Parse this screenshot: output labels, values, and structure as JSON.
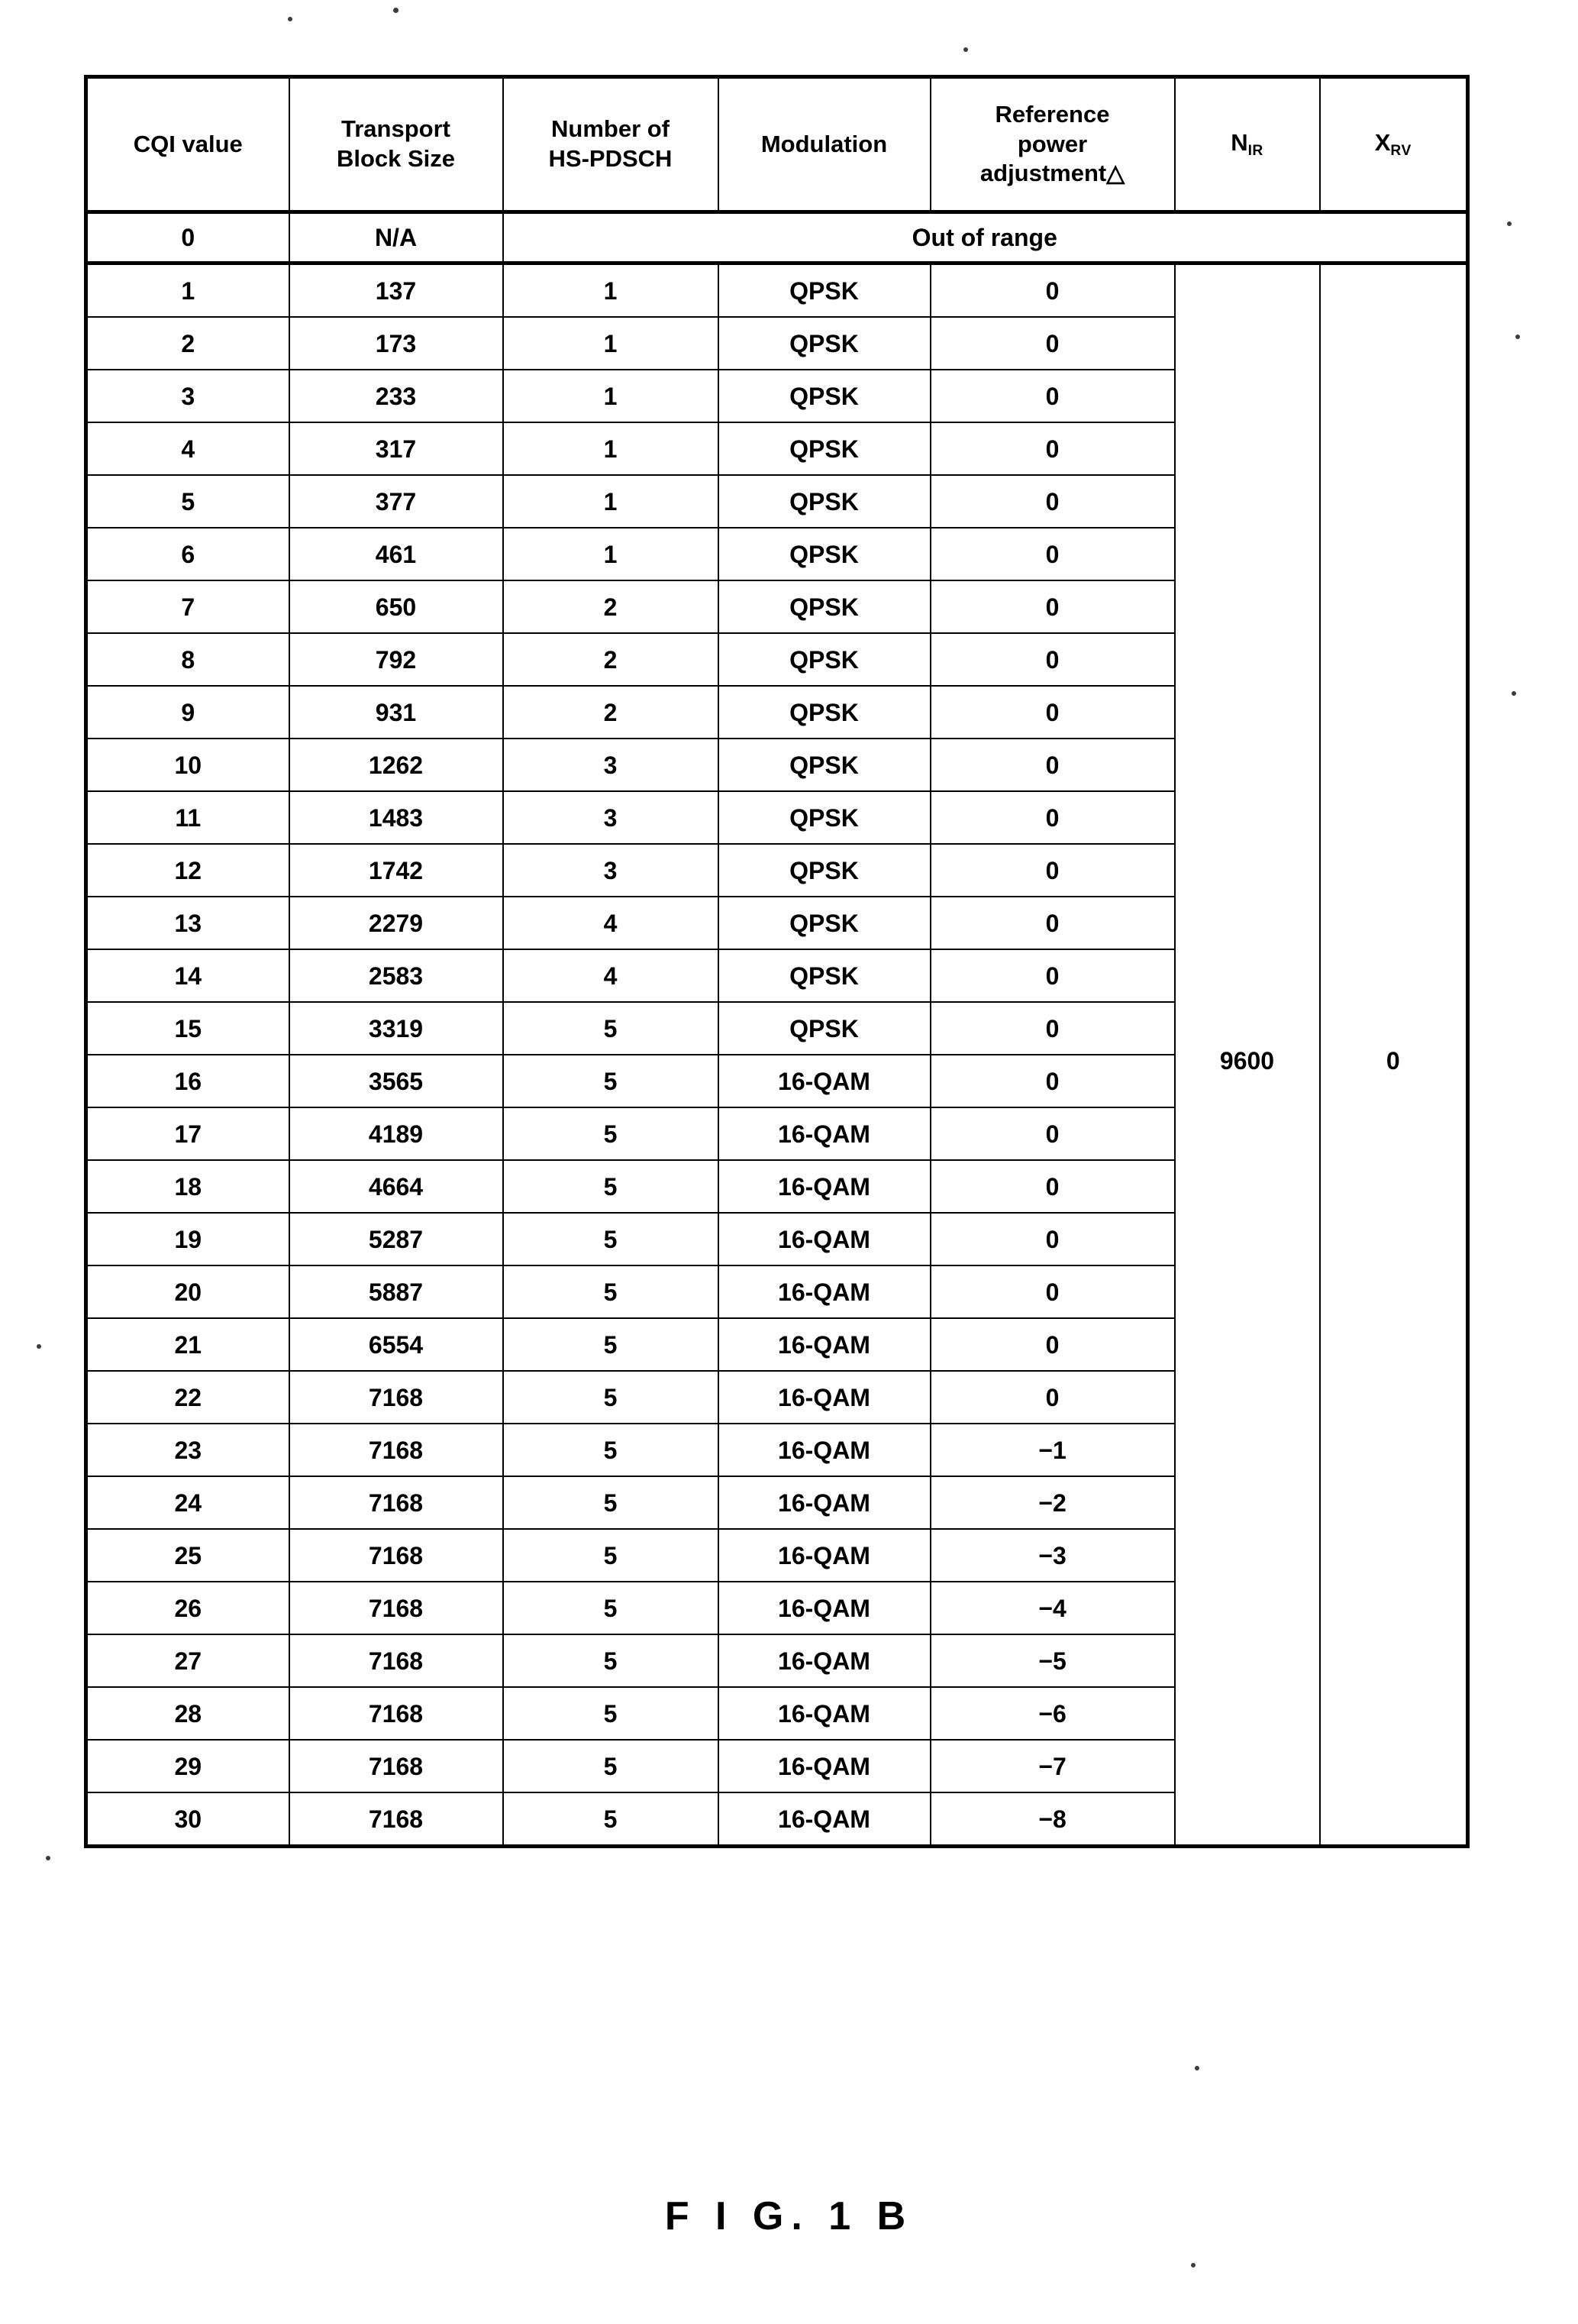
{
  "figure": {
    "caption": "F I G.  1 B"
  },
  "table": {
    "columns": [
      {
        "id": "cqi",
        "label_lines": [
          "CQI value"
        ]
      },
      {
        "id": "tbs",
        "label_lines": [
          "Transport",
          "Block Size"
        ]
      },
      {
        "id": "pdsch",
        "label_lines": [
          "Number of",
          "HS-PDSCH"
        ]
      },
      {
        "id": "mod",
        "label_lines": [
          "Modulation"
        ]
      },
      {
        "id": "ref",
        "label_lines": [
          "Reference",
          "power",
          "adjustment△"
        ]
      },
      {
        "id": "nir",
        "label_lines": [
          "N"
        ],
        "label_sub": "IR"
      },
      {
        "id": "xrv",
        "label_lines": [
          "X"
        ],
        "label_sub": "RV"
      }
    ],
    "out_of_range_label": "Out of range",
    "nir_value": "9600",
    "xrv_value": "0",
    "rows": [
      {
        "cqi": "0",
        "tbs": "N/A",
        "pdsch": "",
        "mod": "",
        "ref": ""
      },
      {
        "cqi": "1",
        "tbs": "137",
        "pdsch": "1",
        "mod": "QPSK",
        "ref": "0"
      },
      {
        "cqi": "2",
        "tbs": "173",
        "pdsch": "1",
        "mod": "QPSK",
        "ref": "0"
      },
      {
        "cqi": "3",
        "tbs": "233",
        "pdsch": "1",
        "mod": "QPSK",
        "ref": "0"
      },
      {
        "cqi": "4",
        "tbs": "317",
        "pdsch": "1",
        "mod": "QPSK",
        "ref": "0"
      },
      {
        "cqi": "5",
        "tbs": "377",
        "pdsch": "1",
        "mod": "QPSK",
        "ref": "0"
      },
      {
        "cqi": "6",
        "tbs": "461",
        "pdsch": "1",
        "mod": "QPSK",
        "ref": "0"
      },
      {
        "cqi": "7",
        "tbs": "650",
        "pdsch": "2",
        "mod": "QPSK",
        "ref": "0"
      },
      {
        "cqi": "8",
        "tbs": "792",
        "pdsch": "2",
        "mod": "QPSK",
        "ref": "0"
      },
      {
        "cqi": "9",
        "tbs": "931",
        "pdsch": "2",
        "mod": "QPSK",
        "ref": "0"
      },
      {
        "cqi": "10",
        "tbs": "1262",
        "pdsch": "3",
        "mod": "QPSK",
        "ref": "0"
      },
      {
        "cqi": "11",
        "tbs": "1483",
        "pdsch": "3",
        "mod": "QPSK",
        "ref": "0"
      },
      {
        "cqi": "12",
        "tbs": "1742",
        "pdsch": "3",
        "mod": "QPSK",
        "ref": "0"
      },
      {
        "cqi": "13",
        "tbs": "2279",
        "pdsch": "4",
        "mod": "QPSK",
        "ref": "0"
      },
      {
        "cqi": "14",
        "tbs": "2583",
        "pdsch": "4",
        "mod": "QPSK",
        "ref": "0"
      },
      {
        "cqi": "15",
        "tbs": "3319",
        "pdsch": "5",
        "mod": "QPSK",
        "ref": "0"
      },
      {
        "cqi": "16",
        "tbs": "3565",
        "pdsch": "5",
        "mod": "16-QAM",
        "ref": "0"
      },
      {
        "cqi": "17",
        "tbs": "4189",
        "pdsch": "5",
        "mod": "16-QAM",
        "ref": "0"
      },
      {
        "cqi": "18",
        "tbs": "4664",
        "pdsch": "5",
        "mod": "16-QAM",
        "ref": "0"
      },
      {
        "cqi": "19",
        "tbs": "5287",
        "pdsch": "5",
        "mod": "16-QAM",
        "ref": "0"
      },
      {
        "cqi": "20",
        "tbs": "5887",
        "pdsch": "5",
        "mod": "16-QAM",
        "ref": "0"
      },
      {
        "cqi": "21",
        "tbs": "6554",
        "pdsch": "5",
        "mod": "16-QAM",
        "ref": "0"
      },
      {
        "cqi": "22",
        "tbs": "7168",
        "pdsch": "5",
        "mod": "16-QAM",
        "ref": "0"
      },
      {
        "cqi": "23",
        "tbs": "7168",
        "pdsch": "5",
        "mod": "16-QAM",
        "ref": "−1"
      },
      {
        "cqi": "24",
        "tbs": "7168",
        "pdsch": "5",
        "mod": "16-QAM",
        "ref": "−2"
      },
      {
        "cqi": "25",
        "tbs": "7168",
        "pdsch": "5",
        "mod": "16-QAM",
        "ref": "−3"
      },
      {
        "cqi": "26",
        "tbs": "7168",
        "pdsch": "5",
        "mod": "16-QAM",
        "ref": "−4"
      },
      {
        "cqi": "27",
        "tbs": "7168",
        "pdsch": "5",
        "mod": "16-QAM",
        "ref": "−5"
      },
      {
        "cqi": "28",
        "tbs": "7168",
        "pdsch": "5",
        "mod": "16-QAM",
        "ref": "−6"
      },
      {
        "cqi": "29",
        "tbs": "7168",
        "pdsch": "5",
        "mod": "16-QAM",
        "ref": "−7"
      },
      {
        "cqi": "30",
        "tbs": "7168",
        "pdsch": "5",
        "mod": "16-QAM",
        "ref": "−8"
      }
    ]
  }
}
